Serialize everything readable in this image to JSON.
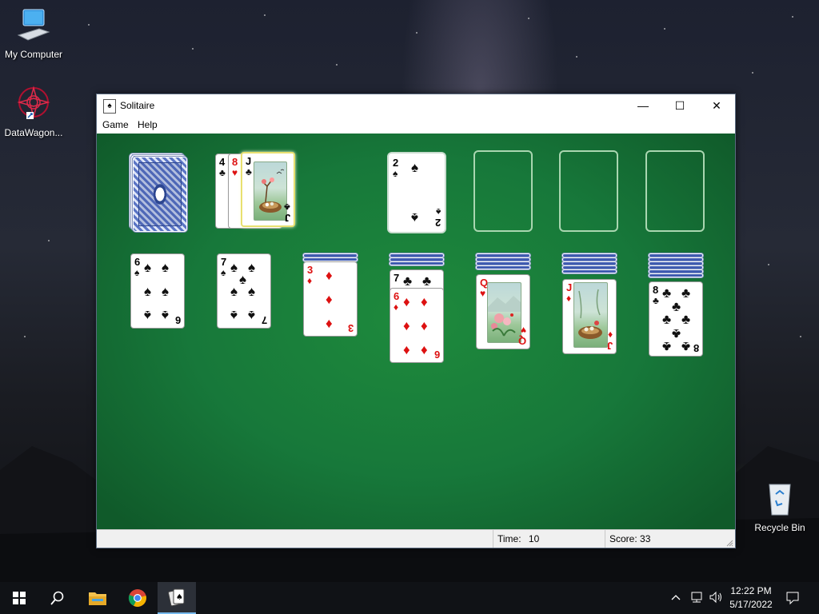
{
  "desktop": {
    "icons": [
      {
        "label": "My Computer"
      },
      {
        "label": "DataWagon..."
      },
      {
        "label": "Recycle Bin"
      }
    ]
  },
  "window": {
    "title": "Solitaire",
    "controls": {
      "minimize": "—",
      "maximize": "☐",
      "close": "✕"
    },
    "menu": [
      "Game",
      "Help"
    ],
    "status": {
      "time_label": "Time:",
      "time_value": "10",
      "score_label": "Score:",
      "score_value": "33"
    }
  },
  "game": {
    "stock": {
      "face_down": true
    },
    "waste": [
      {
        "rank": "4",
        "suit": "♣",
        "color": "black"
      },
      {
        "rank": "8",
        "suit": "♥",
        "color": "red"
      },
      {
        "rank": "J",
        "suit": "♣",
        "color": "black",
        "face_card": true
      }
    ],
    "foundations": [
      {
        "rank": "2",
        "suit": "♠",
        "color": "black"
      },
      null,
      null,
      null
    ],
    "tableau": [
      {
        "hidden": 0,
        "top": {
          "rank": "6",
          "suit": "♠",
          "color": "black"
        }
      },
      {
        "hidden": 0,
        "top": {
          "rank": "7",
          "suit": "♠",
          "color": "black"
        }
      },
      {
        "hidden": 2,
        "top": {
          "rank": "3",
          "suit": "♦",
          "color": "red"
        }
      },
      {
        "hidden": 3,
        "mid": {
          "rank": "7",
          "suit": "♣",
          "color": "black"
        },
        "top": {
          "rank": "6",
          "suit": "♦",
          "color": "red"
        }
      },
      {
        "hidden": 4,
        "top": {
          "rank": "Q",
          "suit": "♥",
          "color": "red",
          "face_card": true
        }
      },
      {
        "hidden": 5,
        "top": {
          "rank": "J",
          "suit": "♦",
          "color": "red",
          "face_card": true
        }
      },
      {
        "hidden": 6,
        "top": {
          "rank": "8",
          "suit": "♣",
          "color": "black"
        }
      }
    ]
  },
  "taskbar": {
    "clock_time": "12:22 PM",
    "clock_date": "5/17/2022"
  },
  "colors": {
    "felt": "#17783a",
    "card_red": "#d11111",
    "taskbar": "#101216",
    "accent": "#76b9ed"
  }
}
